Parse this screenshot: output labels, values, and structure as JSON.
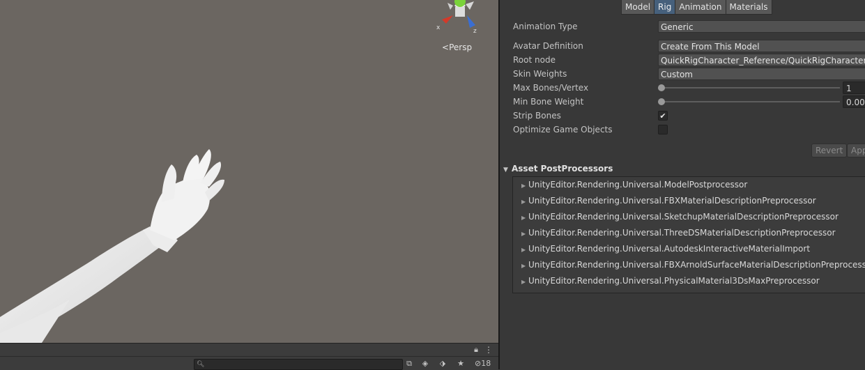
{
  "scene_view": {
    "persp_label": "Persp",
    "gizmo": {
      "x_axis": "x",
      "z_axis": "z"
    },
    "hidden_count": "18"
  },
  "inspector": {
    "tabs": [
      {
        "label": "Model",
        "active": false
      },
      {
        "label": "Rig",
        "active": true
      },
      {
        "label": "Animation",
        "active": false
      },
      {
        "label": "Materials",
        "active": false
      }
    ],
    "properties": {
      "animation_type": {
        "label": "Animation Type",
        "value": "Generic"
      },
      "avatar_definition": {
        "label": "Avatar Definition",
        "value": "Create From This Model"
      },
      "root_node": {
        "label": "Root node",
        "value": "QuickRigCharacter_Reference/QuickRigCharacter_H"
      },
      "skin_weights": {
        "label": "Skin Weights",
        "value": "Custom"
      },
      "max_bones_vertex": {
        "label": "Max Bones/Vertex",
        "value": "1"
      },
      "min_bone_weight": {
        "label": "Min Bone Weight",
        "value": "0.00"
      },
      "strip_bones": {
        "label": "Strip Bones",
        "checked": true
      },
      "optimize_game_objects": {
        "label": "Optimize Game Objects",
        "checked": false
      }
    },
    "buttons": {
      "revert": "Revert",
      "apply": "App"
    },
    "asset_postprocessors": {
      "title": "Asset PostProcessors",
      "items": [
        "UnityEditor.Rendering.Universal.ModelPostprocessor",
        "UnityEditor.Rendering.Universal.FBXMaterialDescriptionPreprocessor",
        "UnityEditor.Rendering.Universal.SketchupMaterialDescriptionPreprocessor",
        "UnityEditor.Rendering.Universal.ThreeDSMaterialDescriptionPreprocessor",
        "UnityEditor.Rendering.Universal.AutodeskInteractiveMaterialImport",
        "UnityEditor.Rendering.Universal.FBXArnoldSurfaceMaterialDescriptionPreprocessor",
        "UnityEditor.Rendering.Universal.PhysicalMaterial3DsMaxPreprocessor"
      ]
    }
  },
  "colors": {
    "scene_bg": "#6b6661",
    "panel_bg": "#383838",
    "active_tab": "#46607c",
    "gizmo_x": "#d23a2a",
    "gizmo_y": "#7ad23a",
    "gizmo_z": "#3a6ed2"
  }
}
